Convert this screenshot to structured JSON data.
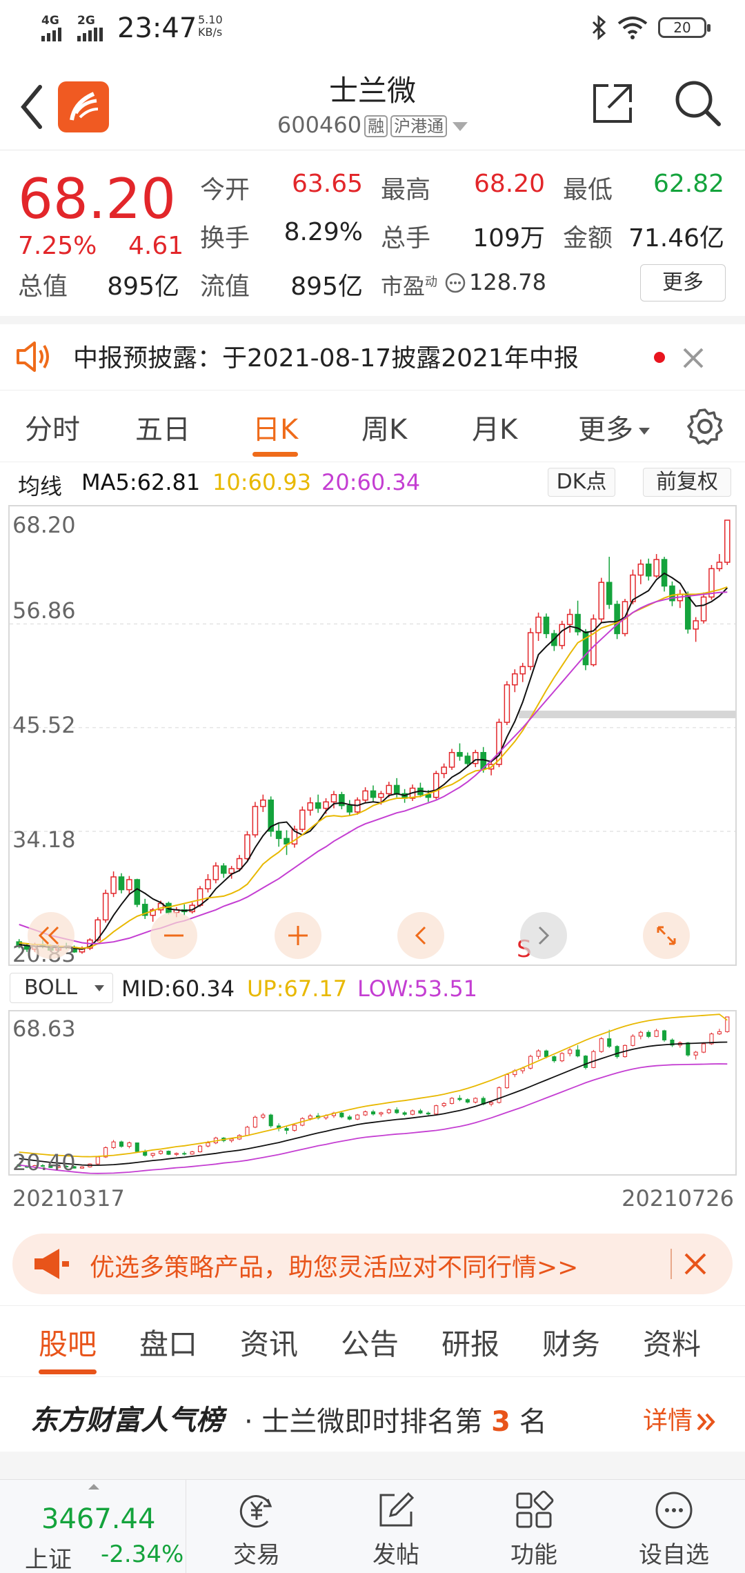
{
  "status_bar": {
    "net1": "4G",
    "net2": "2G",
    "time": "23:47",
    "speed_value": "5.10",
    "speed_unit": "KB/s",
    "battery": "20"
  },
  "header": {
    "title": "士兰微",
    "code": "600460",
    "tag1": "融",
    "tag2": "沪港通"
  },
  "quote": {
    "price": "68.20",
    "change_pct": "7.25%",
    "change": "4.61",
    "open_label": "今开",
    "open": "63.65",
    "high_label": "最高",
    "high": "68.20",
    "low_label": "最低",
    "low": "62.82",
    "turnover_label": "换手",
    "turnover": "8.29%",
    "volume_label": "总手",
    "volume": "109万",
    "amount_label": "金额",
    "amount": "71.46亿",
    "mktcap_label": "总值",
    "mktcap": "895亿",
    "float_label": "流值",
    "float": "895亿",
    "pe_label": "市盈",
    "pe_sup": "动",
    "pe": "128.78",
    "more_label": "更多"
  },
  "notice": {
    "text": "中报预披露：于2021-08-17披露2021年中报"
  },
  "period_tabs": [
    "分时",
    "五日",
    "日K",
    "周K",
    "月K",
    "更多"
  ],
  "ma_bar": {
    "label": "均线",
    "ma5": "MA5:62.81",
    "ma10": "10:60.93",
    "ma20": "20:60.34",
    "dk_label": "DK点",
    "fq_label": "前复权"
  },
  "kchart_labels": {
    "y1": "68.20",
    "y2": "56.86",
    "y3": "45.52",
    "y4": "34.18",
    "y5": "20.83",
    "s_marker": "S"
  },
  "boll_bar": {
    "select": "BOLL",
    "mid": "MID:60.34",
    "up": "UP:67.17",
    "low": "LOW:53.51"
  },
  "boll_labels": {
    "y_top": "68.63",
    "y_bottom": "20.40"
  },
  "dates": {
    "start": "20210317",
    "end": "20210726"
  },
  "promo": {
    "text": "优选多策略产品，助您灵活应对不同行情>>"
  },
  "info_tabs": [
    "股吧",
    "盘口",
    "资讯",
    "公告",
    "研报",
    "财务",
    "资料"
  ],
  "rank": {
    "brand": "东方财富人气榜",
    "text_before": "· 士兰微即时排名第",
    "rank_num": "3",
    "text_after": "名",
    "detail": "详情"
  },
  "bottom_bar": {
    "index_value": "3467.44",
    "index_name": "上证",
    "index_change": "-2.34%",
    "items": [
      "交易",
      "发帖",
      "功能",
      "设自选"
    ]
  },
  "colors": {
    "up": "#e2262a",
    "down": "#14a33c",
    "accent": "#ef6b1a",
    "ma5": "#111111",
    "ma10": "#e8b800",
    "ma20": "#c43ed2"
  },
  "chart_data": {
    "type": "candlestick",
    "x_range": [
      "20210317",
      "20210726"
    ],
    "ylim": [
      20.83,
      68.2
    ],
    "yticks": [
      68.2,
      56.86,
      45.52,
      34.18,
      20.83
    ],
    "ohlc": [
      [
        22.1,
        22.4,
        21.4,
        21.6
      ],
      [
        21.6,
        21.9,
        21.0,
        21.3
      ],
      [
        21.3,
        22.0,
        21.0,
        21.8
      ],
      [
        21.8,
        22.3,
        21.4,
        21.6
      ],
      [
        21.6,
        21.8,
        21.1,
        21.2
      ],
      [
        21.2,
        21.8,
        21.0,
        21.6
      ],
      [
        21.6,
        22.0,
        21.3,
        21.5
      ],
      [
        21.5,
        21.7,
        20.9,
        21.0
      ],
      [
        21.0,
        21.6,
        20.8,
        21.4
      ],
      [
        21.4,
        22.5,
        21.2,
        22.3
      ],
      [
        22.3,
        24.8,
        22.1,
        24.5
      ],
      [
        24.5,
        27.8,
        24.2,
        27.4
      ],
      [
        27.4,
        29.8,
        27.0,
        29.2
      ],
      [
        29.2,
        29.6,
        27.4,
        27.8
      ],
      [
        27.8,
        29.3,
        27.2,
        28.9
      ],
      [
        28.9,
        29.0,
        25.9,
        26.2
      ],
      [
        26.2,
        26.8,
        24.6,
        25.0
      ],
      [
        25.0,
        25.8,
        24.3,
        25.6
      ],
      [
        25.6,
        26.6,
        25.2,
        26.3
      ],
      [
        26.3,
        26.5,
        25.1,
        25.3
      ],
      [
        25.3,
        25.9,
        24.8,
        25.6
      ],
      [
        25.6,
        26.2,
        25.0,
        25.4
      ],
      [
        25.4,
        26.4,
        25.2,
        26.1
      ],
      [
        26.1,
        28.2,
        25.9,
        27.9
      ],
      [
        27.9,
        29.5,
        27.5,
        28.9
      ],
      [
        28.9,
        30.8,
        28.5,
        30.4
      ],
      [
        30.4,
        30.7,
        29.1,
        29.6
      ],
      [
        29.6,
        30.4,
        29.0,
        30.1
      ],
      [
        30.1,
        31.6,
        29.8,
        31.2
      ],
      [
        31.2,
        34.2,
        31.0,
        33.8
      ],
      [
        33.8,
        37.4,
        33.5,
        36.9
      ],
      [
        36.9,
        38.2,
        36.3,
        37.6
      ],
      [
        37.6,
        38.0,
        33.6,
        34.2
      ],
      [
        34.2,
        35.0,
        32.5,
        33.4
      ],
      [
        33.4,
        34.3,
        31.6,
        32.8
      ],
      [
        32.8,
        34.8,
        32.4,
        34.4
      ],
      [
        34.4,
        36.9,
        34.1,
        36.5
      ],
      [
        36.5,
        37.9,
        35.9,
        37.3
      ],
      [
        37.3,
        38.2,
        36.2,
        36.7
      ],
      [
        36.7,
        37.8,
        36.1,
        37.4
      ],
      [
        37.4,
        38.6,
        36.7,
        38.2
      ],
      [
        38.2,
        38.5,
        36.6,
        37.0
      ],
      [
        37.0,
        37.6,
        35.9,
        36.3
      ],
      [
        36.3,
        37.9,
        36.0,
        37.6
      ],
      [
        37.6,
        39.0,
        37.3,
        38.6
      ],
      [
        38.6,
        39.2,
        37.4,
        37.9
      ],
      [
        37.9,
        38.6,
        37.1,
        38.3
      ],
      [
        38.3,
        39.6,
        37.9,
        39.2
      ],
      [
        39.2,
        40.0,
        37.9,
        38.3
      ],
      [
        38.3,
        38.8,
        37.3,
        37.8
      ],
      [
        37.8,
        39.3,
        37.5,
        38.9
      ],
      [
        38.9,
        39.5,
        37.9,
        38.2
      ],
      [
        38.2,
        38.7,
        37.4,
        37.9
      ],
      [
        37.9,
        40.8,
        37.7,
        40.5
      ],
      [
        40.5,
        41.6,
        40.0,
        41.2
      ],
      [
        41.2,
        43.2,
        40.9,
        42.8
      ],
      [
        42.8,
        43.8,
        41.9,
        42.4
      ],
      [
        42.4,
        42.8,
        41.2,
        41.6
      ],
      [
        41.6,
        43.1,
        41.2,
        42.8
      ],
      [
        42.8,
        43.4,
        40.6,
        41.0
      ],
      [
        41.0,
        42.0,
        40.3,
        41.5
      ],
      [
        41.5,
        46.5,
        41.2,
        46.1
      ],
      [
        46.1,
        50.6,
        45.8,
        50.2
      ],
      [
        50.2,
        51.9,
        49.4,
        51.4
      ],
      [
        51.4,
        52.6,
        50.5,
        52.2
      ],
      [
        52.2,
        56.4,
        51.8,
        55.9
      ],
      [
        55.9,
        58.1,
        55.0,
        57.6
      ],
      [
        57.6,
        58.0,
        55.3,
        55.8
      ],
      [
        55.8,
        56.2,
        53.9,
        54.5
      ],
      [
        54.5,
        57.2,
        54.1,
        56.8
      ],
      [
        56.8,
        58.5,
        55.9,
        57.9
      ],
      [
        57.9,
        59.4,
        55.6,
        56.0
      ],
      [
        56.0,
        56.3,
        51.8,
        52.4
      ],
      [
        52.4,
        57.9,
        52.2,
        57.4
      ],
      [
        57.4,
        61.9,
        57.0,
        61.4
      ],
      [
        61.4,
        64.2,
        58.5,
        59.0
      ],
      [
        59.0,
        59.4,
        55.2,
        55.8
      ],
      [
        55.8,
        59.6,
        55.5,
        59.3
      ],
      [
        59.3,
        62.8,
        59.0,
        62.2
      ],
      [
        62.2,
        63.9,
        61.2,
        63.4
      ],
      [
        63.4,
        64.0,
        61.6,
        62.1
      ],
      [
        62.1,
        64.5,
        61.9,
        63.9
      ],
      [
        63.9,
        64.2,
        60.4,
        61.0
      ],
      [
        61.0,
        61.5,
        58.8,
        59.4
      ],
      [
        59.4,
        60.6,
        58.6,
        60.1
      ],
      [
        60.1,
        60.4,
        55.8,
        56.3
      ],
      [
        56.3,
        57.6,
        54.9,
        57.2
      ],
      [
        57.2,
        60.3,
        56.9,
        59.8
      ],
      [
        59.8,
        63.3,
        59.5,
        62.9
      ],
      [
        62.9,
        64.5,
        62.6,
        63.6
      ],
      [
        63.6,
        68.2,
        63.3,
        68.2
      ]
    ],
    "series": [
      {
        "name": "MA5",
        "values": [
          21.8,
          21.7,
          21.6,
          21.6,
          21.5,
          21.5,
          21.5,
          21.4,
          21.3,
          21.6,
          22.4,
          23.6,
          25.0,
          26.2,
          27.3,
          27.9,
          27.4,
          26.8,
          26.4,
          25.7,
          25.6,
          25.5,
          25.6,
          26.1,
          26.8,
          27.9,
          28.7,
          29.5,
          29.9,
          30.9,
          32.4,
          33.7,
          34.7,
          35.1,
          35.2,
          34.2,
          33.8,
          34.2,
          35.2,
          36.4,
          37.2,
          37.3,
          37.1,
          37.0,
          37.3,
          37.4,
          37.3,
          38.1,
          38.3,
          38.1,
          38.4,
          38.6,
          38.5,
          38.7,
          39.3,
          40.1,
          40.6,
          41.3,
          42.0,
          42.0,
          41.8,
          42.5,
          44.5,
          46.2,
          48.3,
          50.9,
          53.5,
          54.4,
          55.2,
          56.1,
          56.6,
          56.4,
          55.9,
          56.1,
          57.0,
          57.1,
          57.1,
          57.6,
          59.5,
          60.0,
          60.5,
          61.7,
          62.4,
          61.9,
          61.3,
          59.9,
          58.8,
          58.9,
          59.3,
          59.9,
          60.8
        ]
      },
      {
        "name": "MA10",
        "values": [
          22.0,
          21.9,
          21.8,
          21.8,
          21.7,
          21.6,
          21.6,
          21.5,
          21.4,
          21.5,
          21.9,
          22.5,
          23.2,
          23.8,
          24.4,
          24.9,
          25.2,
          25.5,
          25.8,
          25.9,
          26.1,
          26.3,
          26.5,
          26.7,
          26.9,
          27.0,
          27.1,
          27.4,
          27.8,
          28.4,
          29.5,
          30.6,
          31.3,
          31.9,
          32.7,
          33.2,
          33.8,
          34.5,
          35.2,
          35.8,
          35.9,
          35.8,
          35.9,
          36.1,
          36.5,
          37.0,
          37.3,
          37.6,
          37.8,
          37.8,
          37.9,
          38.0,
          38.3,
          38.6,
          39.0,
          39.3,
          39.8,
          40.4,
          40.8,
          40.9,
          41.2,
          42.0,
          43.0,
          44.0,
          45.2,
          46.6,
          48.1,
          49.6,
          51.0,
          52.3,
          53.6,
          54.8,
          55.3,
          55.8,
          56.4,
          56.7,
          57.0,
          57.4,
          58.1,
          58.5,
          58.9,
          59.3,
          59.7,
          60.0,
          60.1,
          60.1,
          60.1,
          60.2,
          60.4,
          60.6,
          60.9
        ]
      },
      {
        "name": "MA20",
        "values": [
          24.0,
          23.7,
          23.4,
          23.1,
          22.8,
          22.6,
          22.4,
          22.2,
          22.0,
          21.9,
          21.9,
          22.0,
          22.1,
          22.3,
          22.5,
          22.8,
          23.1,
          23.4,
          23.6,
          23.9,
          24.2,
          24.4,
          24.7,
          25.0,
          25.3,
          25.6,
          26.0,
          26.3,
          26.6,
          27.0,
          27.5,
          28.0,
          28.5,
          29.0,
          29.6,
          30.2,
          30.8,
          31.4,
          32.0,
          32.5,
          33.1,
          33.6,
          34.1,
          34.6,
          35.0,
          35.3,
          35.6,
          35.9,
          36.2,
          36.4,
          36.7,
          37.0,
          37.3,
          37.6,
          38.0,
          38.5,
          39.0,
          39.6,
          40.3,
          41.1,
          41.9,
          42.8,
          43.7,
          44.6,
          45.5,
          46.5,
          47.5,
          48.5,
          49.5,
          50.5,
          51.5,
          52.5,
          53.5,
          54.4,
          55.2,
          56.0,
          56.8,
          57.5,
          58.1,
          58.6,
          59.0,
          59.3,
          59.5,
          59.7,
          59.8,
          59.9,
          60.0,
          60.1,
          60.2,
          60.3,
          60.34
        ]
      }
    ],
    "boll": {
      "ylim": [
        20.4,
        68.63
      ],
      "mid": [
        24.0,
        23.7,
        23.4,
        23.1,
        22.8,
        22.6,
        22.4,
        22.2,
        22.0,
        21.9,
        21.9,
        22.0,
        22.1,
        22.3,
        22.5,
        22.8,
        23.1,
        23.4,
        23.6,
        23.9,
        24.2,
        24.4,
        24.7,
        25.0,
        25.3,
        25.6,
        26.0,
        26.3,
        26.6,
        27.0,
        27.5,
        28.0,
        28.5,
        29.0,
        29.6,
        30.2,
        30.8,
        31.4,
        32.0,
        32.5,
        33.1,
        33.6,
        34.1,
        34.6,
        35.0,
        35.3,
        35.6,
        35.9,
        36.2,
        36.4,
        36.7,
        37.0,
        37.3,
        37.6,
        38.0,
        38.5,
        39.0,
        39.6,
        40.3,
        41.1,
        41.9,
        42.8,
        43.7,
        44.6,
        45.5,
        46.5,
        47.5,
        48.5,
        49.5,
        50.5,
        51.5,
        52.5,
        53.5,
        54.4,
        55.2,
        56.0,
        56.8,
        57.5,
        58.1,
        58.6,
        59.0,
        59.3,
        59.5,
        59.7,
        59.8,
        59.9,
        60.0,
        60.1,
        60.2,
        60.3,
        60.34
      ],
      "up_end": 67.17,
      "low_end": 53.51
    }
  }
}
